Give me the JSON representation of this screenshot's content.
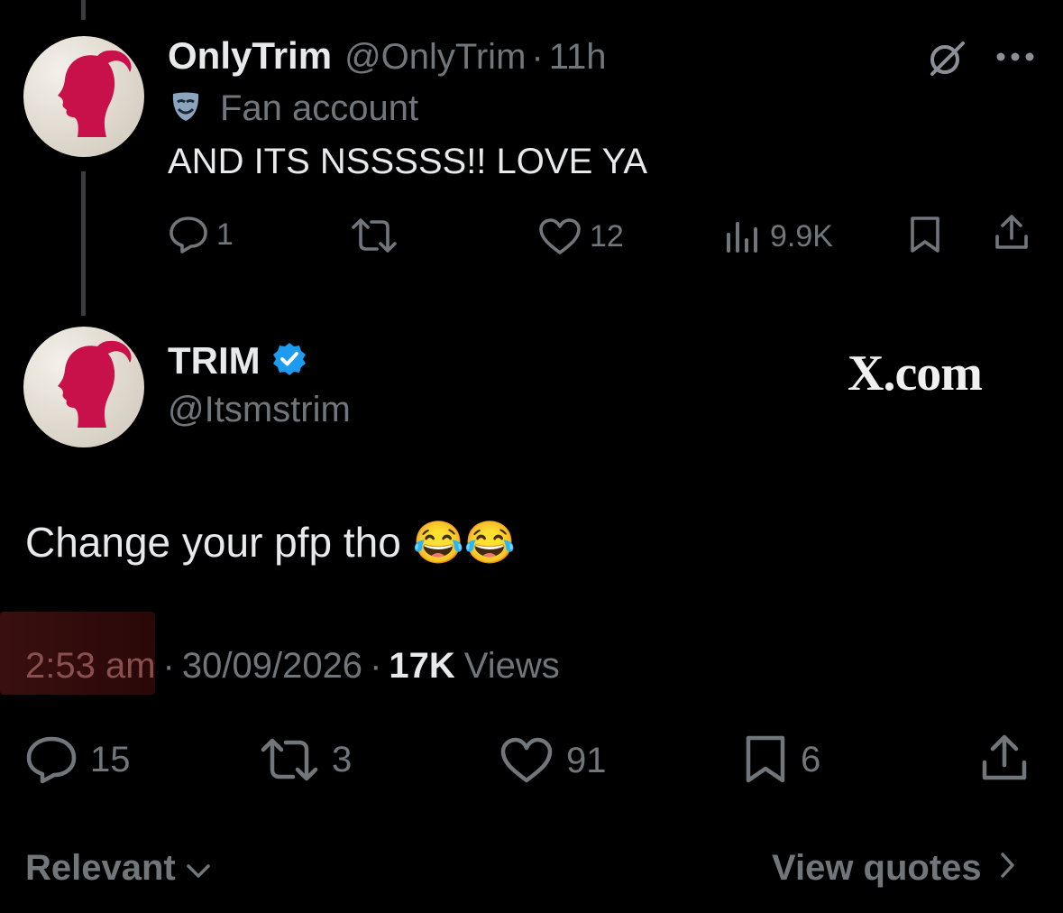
{
  "reply_tweet": {
    "display_name": "OnlyTrim",
    "handle": "@OnlyTrim",
    "separator": "·",
    "time": "11h",
    "label_icon": "mask-icon",
    "label": "Fan account",
    "text": "AND ITS NSSSSS!! LOVE YA",
    "actions": {
      "replies": "1",
      "reposts": "",
      "likes": "12",
      "views": "9.9K"
    }
  },
  "main_tweet": {
    "display_name": "TRIM",
    "verified": true,
    "handle": "@Itsmstrim",
    "watermark": "X.com",
    "text": "Change your pfp tho 😂😂",
    "meta": {
      "time": "2:53 am",
      "sep1": "·",
      "date": "30/09/2026",
      "sep2": "·",
      "views_count": "17K",
      "views_label": "Views"
    },
    "actions": {
      "replies": "15",
      "reposts": "3",
      "likes": "91",
      "bookmarks": "6"
    }
  },
  "footer": {
    "sort_label": "Relevant",
    "quotes_label": "View quotes"
  },
  "colors": {
    "background": "#000000",
    "text": "#e7e9ea",
    "muted": "#71767b",
    "verified": "#1d9bf0",
    "thread_line": "#3a3d40",
    "highlight": "#3a0f0f"
  }
}
